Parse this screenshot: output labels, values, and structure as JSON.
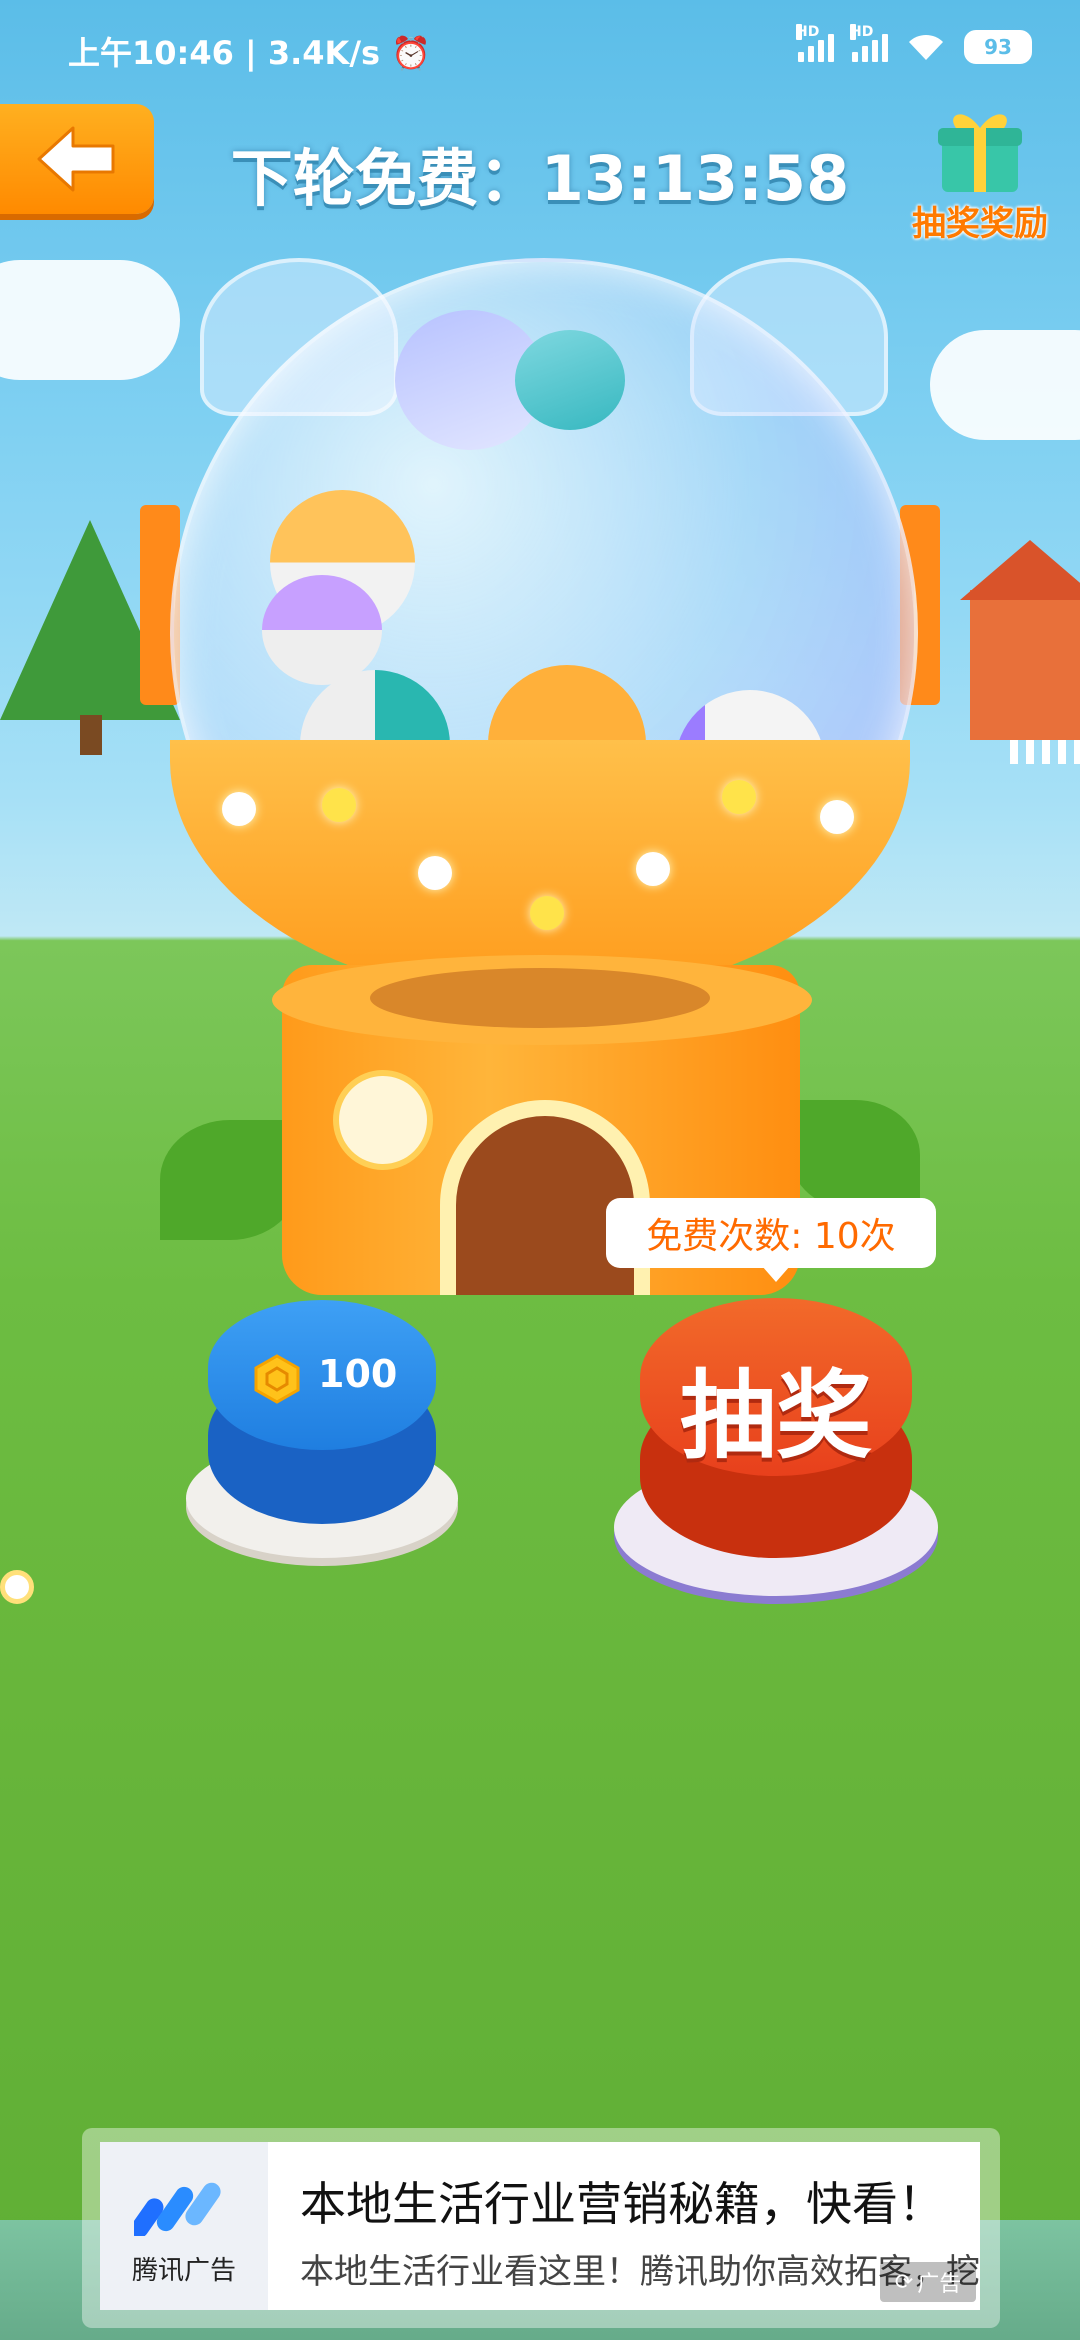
{
  "status_bar": {
    "time": "上午10:46",
    "speed": "3.4K/s",
    "signal1_tag": "HD",
    "signal2_tag": "HD",
    "battery": "93",
    "icons": [
      "alarm-icon",
      "signal-icon",
      "wifi-icon",
      "battery-icon"
    ]
  },
  "header": {
    "back_icon": "arrow-left-icon",
    "timer_label": "下轮免费：",
    "timer_value": "13:13:58",
    "reward_label": "抽奖奖励",
    "reward_icon": "gift-box-icon"
  },
  "machine": {
    "free_count_label": "免费次数: 10次"
  },
  "buttons": {
    "coin_value": "100",
    "coin_icon": "hexagon-coin-icon",
    "draw_label": "抽奖"
  },
  "ad": {
    "brand": "腾讯广告",
    "title": "本地生活行业营销秘籍，快看！",
    "description": "本地生活行业看这里！腾讯助你高效拓客，挖",
    "tag": "广告"
  },
  "colors": {
    "accent_orange": "#ff8a00",
    "draw_button_red": "#e8401c",
    "coin_button_blue": "#1f7ee0",
    "grass": "#6dbd42",
    "sky": "#7fd0f2"
  }
}
